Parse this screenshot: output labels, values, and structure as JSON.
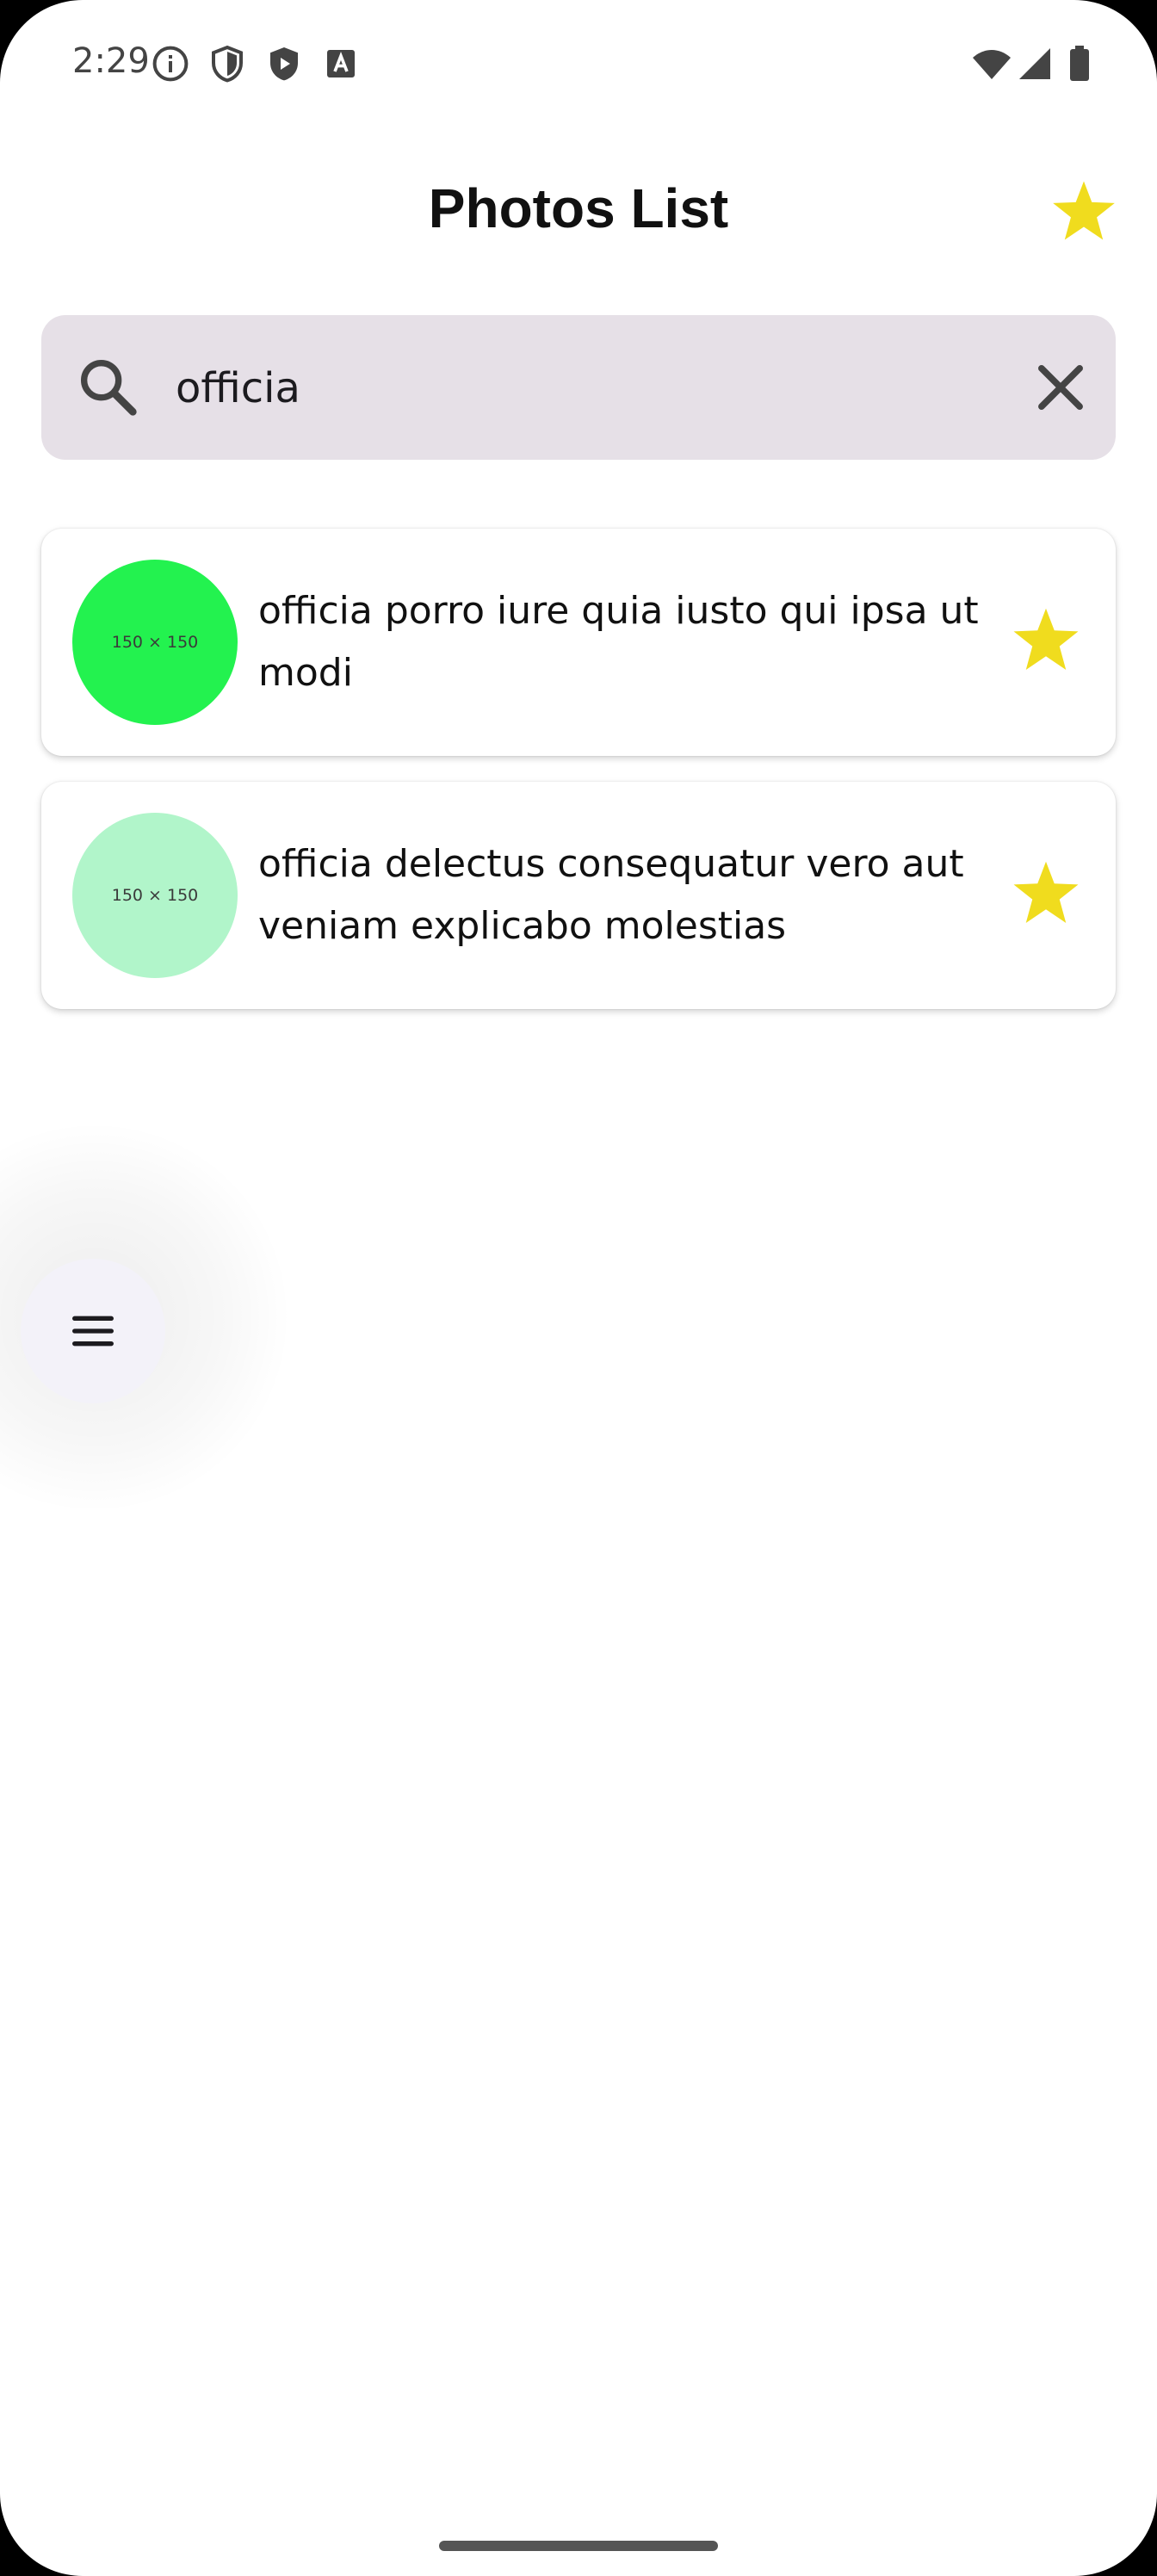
{
  "status_bar": {
    "time": "2:29",
    "left_icons": [
      "info-icon",
      "shield-outline-icon",
      "shield-play-icon",
      "app-a-icon"
    ],
    "right_icons": [
      "wifi-icon",
      "signal-icon",
      "battery-icon"
    ]
  },
  "header": {
    "title": "Photos List",
    "favorites_icon": "star-icon",
    "star_color": "#f0dc1e"
  },
  "search": {
    "value": "officia",
    "placeholder": ""
  },
  "photos": [
    {
      "thumb_label": "150 × 150",
      "thumb_color": "#23f24f",
      "title": "officia porro iure quia iusto qui ipsa ut modi",
      "favorite": true
    },
    {
      "thumb_label": "150 × 150",
      "thumb_color": "#b1f5ca",
      "title": "officia delectus consequatur vero aut veniam explicabo molestias",
      "favorite": true
    }
  ],
  "fab": {
    "icon": "menu-icon"
  }
}
